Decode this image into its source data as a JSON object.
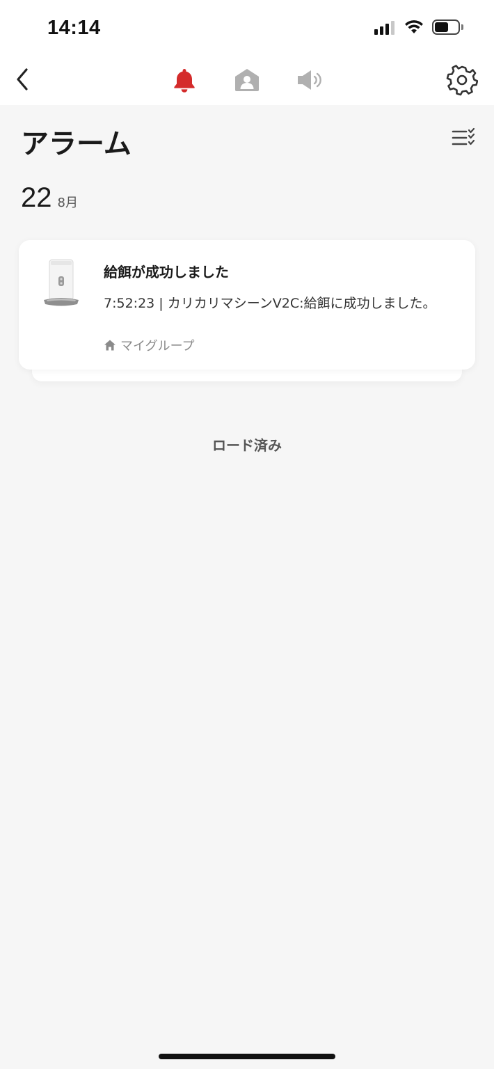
{
  "status_bar": {
    "time": "14:14"
  },
  "nav": {
    "tabs": [
      {
        "icon": "bell-icon",
        "active": true,
        "color": "#d42b2b"
      },
      {
        "icon": "person-icon",
        "active": false,
        "color": "#b0b0b0"
      },
      {
        "icon": "speaker-icon",
        "active": false,
        "color": "#b0b0b0"
      }
    ]
  },
  "page": {
    "title": "アラーム"
  },
  "date_group": {
    "day": "22",
    "month": "8月"
  },
  "alarms": [
    {
      "title": "給餌が成功しました",
      "description": "7:52:23 | カリカリマシーンV2C:給餌に成功しました。",
      "group": "マイグループ"
    }
  ],
  "footer": {
    "loaded_text": "ロード済み"
  },
  "colors": {
    "accent": "#d42b2b",
    "background": "#f6f6f6",
    "card": "#ffffff"
  }
}
